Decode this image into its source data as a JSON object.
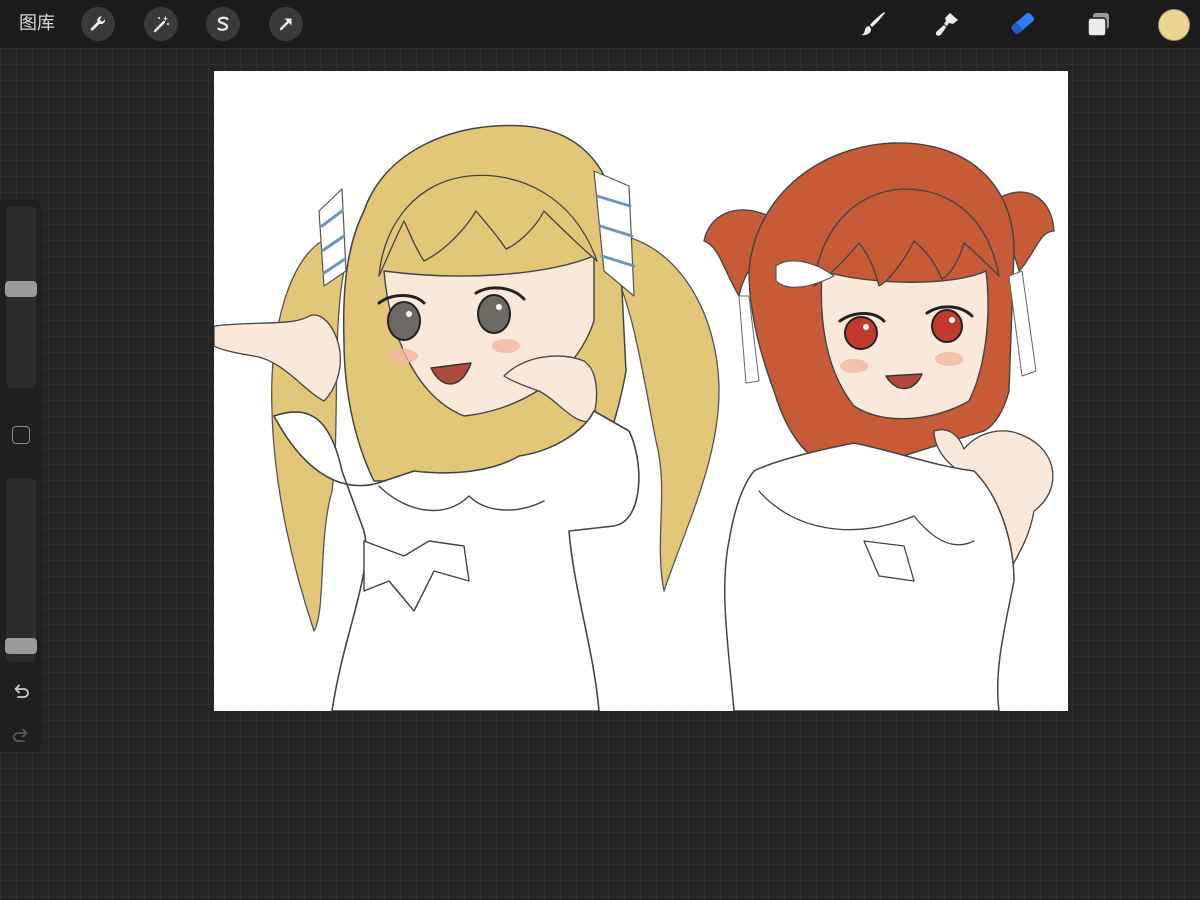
{
  "topbar": {
    "gallery_label": "图库",
    "left_tools": [
      "wrench-icon",
      "magic-wand-icon",
      "selection-icon",
      "transform-arrow-icon"
    ],
    "right_tools": [
      "brush-icon",
      "smudge-icon",
      "eraser-icon",
      "layers-icon"
    ],
    "active_tool": "eraser",
    "current_color": "#E9D590"
  },
  "sidebar": {
    "size_slider_value": 0.55,
    "opacity_slider_value": 0.05,
    "buttons": [
      "modify-square-icon",
      "undo-icon",
      "redo-icon"
    ]
  },
  "canvas": {
    "content": "artwork-two-anime-girls",
    "hair_colors": [
      "#E1C777",
      "#C75A37"
    ]
  }
}
